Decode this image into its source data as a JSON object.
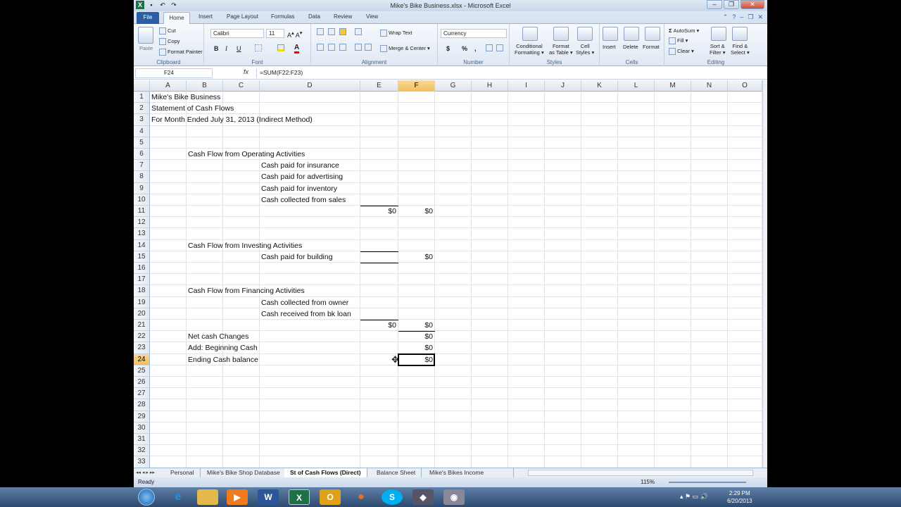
{
  "window": {
    "title": "Mike's Bike Business.xlsx - Microsoft Excel"
  },
  "ribbon_tabs": [
    "File",
    "Home",
    "Insert",
    "Page Layout",
    "Formulas",
    "Data",
    "Review",
    "View"
  ],
  "clipboard": {
    "paste": "Paste",
    "cut": "Cut",
    "copy": "Copy",
    "format_painter": "Format Painter",
    "label": "Clipboard"
  },
  "font": {
    "name": "Calibri",
    "size": "11",
    "bold": "B",
    "italic": "I",
    "underline": "U",
    "label": "Font"
  },
  "alignment": {
    "wrap": "Wrap Text",
    "merge": "Merge & Center",
    "label": "Alignment"
  },
  "number": {
    "format": "Currency",
    "dollar": "$",
    "percent": "%",
    "comma": ",",
    "label": "Number"
  },
  "styles": {
    "conditional": "Conditional",
    "conditional2": "Formatting",
    "format_as": "Format",
    "format_as2": "as Table",
    "cell": "Cell",
    "cell2": "Styles",
    "label": "Styles"
  },
  "cells": {
    "insert": "Insert",
    "delete": "Delete",
    "format": "Format",
    "label": "Cells"
  },
  "editing": {
    "autosum": "AutoSum",
    "fill": "Fill",
    "clear": "Clear",
    "sort": "Sort &",
    "sort2": "Filter",
    "find": "Find &",
    "find2": "Select",
    "label": "Editing"
  },
  "formula_bar": {
    "name_box": "F24",
    "fx": "fx",
    "formula": "=SUM(F22:F23)"
  },
  "columns": [
    "A",
    "B",
    "C",
    "D",
    "E",
    "F",
    "G",
    "H",
    "I",
    "J",
    "K",
    "L",
    "M",
    "N",
    "O"
  ],
  "rows": [
    "1",
    "2",
    "3",
    "4",
    "5",
    "6",
    "7",
    "8",
    "9",
    "10",
    "11",
    "12",
    "13",
    "14",
    "15",
    "16",
    "17",
    "18",
    "19",
    "20",
    "21",
    "22",
    "23",
    "24",
    "25",
    "26",
    "27",
    "28",
    "29",
    "30",
    "31",
    "32",
    "33"
  ],
  "cells_content": {
    "a1": "Mike's Bike Business",
    "a2": "Statement of Cash Flows",
    "a3": "For Month Ended July 31, 2013 (Indirect Method)",
    "b6": "Cash Flow from Operating Activities",
    "d7": "Cash paid for insurance",
    "d8": "Cash paid for advertising",
    "d9": "Cash paid for inventory",
    "d10": "Cash collected from sales",
    "e11": "$0",
    "f11": "$0",
    "b14": "Cash Flow from Investing Activities",
    "d15": "Cash paid for building",
    "f15": "$0",
    "b18": "Cash Flow from Financing Activities",
    "d19": "Cash collected from owner",
    "d20": "Cash received from bk loan",
    "e21": "$0",
    "f21": "$0",
    "b22": "Net cash Changes",
    "f22": "$0",
    "b23": "Add: Beginning Cash",
    "f23": "$0",
    "b24": "Ending Cash balance",
    "f24": "$0"
  },
  "sheet_tabs": [
    "Personal",
    "Mike's Bike Shop Database",
    "St of Cash Flows (Direct)",
    "Balance Sheet",
    "Mike's Bikes Income Stateme"
  ],
  "status": {
    "ready": "Ready",
    "zoom": "115%"
  },
  "clock": {
    "time": "2:29 PM",
    "date": "6/20/2013"
  }
}
